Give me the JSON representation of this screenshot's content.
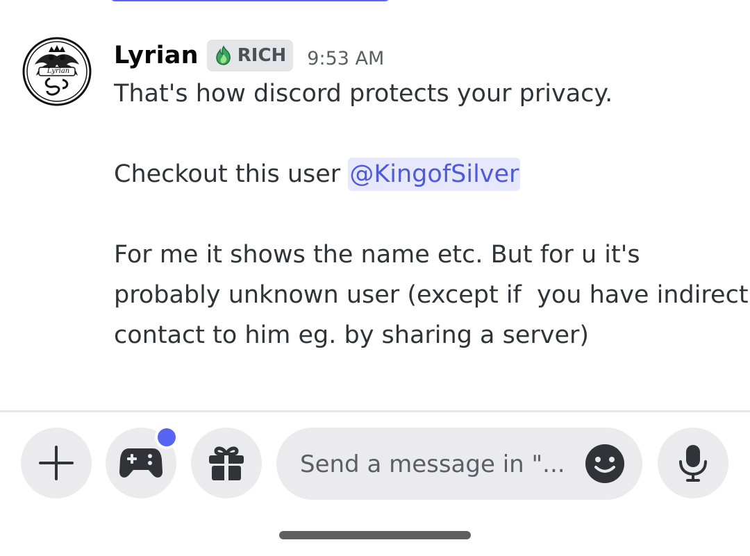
{
  "message": {
    "author": "Lyrian",
    "avatar_text": "Lyrian",
    "tag": "RICH",
    "timestamp": "9:53 AM",
    "lines": {
      "l1": "That's how discord protects your privacy.",
      "l2_prefix": "Checkout this user ",
      "l2_mention": "@KingofSilver",
      "l3": "For me it shows the name etc. But for u it's",
      "l4": "probably unknown user (except if  you have indirect",
      "l5": "contact to him eg. by sharing a server)"
    }
  },
  "composer": {
    "placeholder": "Send a message in \"...",
    "buttons": {
      "add": "plus-icon",
      "activities": "gamepad-icon",
      "gift": "gift-icon",
      "emoji": "smiley-icon",
      "voice": "microphone-icon"
    },
    "activities_has_notification": true
  },
  "colors": {
    "accent": "#5865f2",
    "mention_text": "#4e5ad9",
    "mention_bg": "#e6e8fd",
    "button_bg": "#ebebed",
    "tag_icon": "#3ba55d"
  }
}
